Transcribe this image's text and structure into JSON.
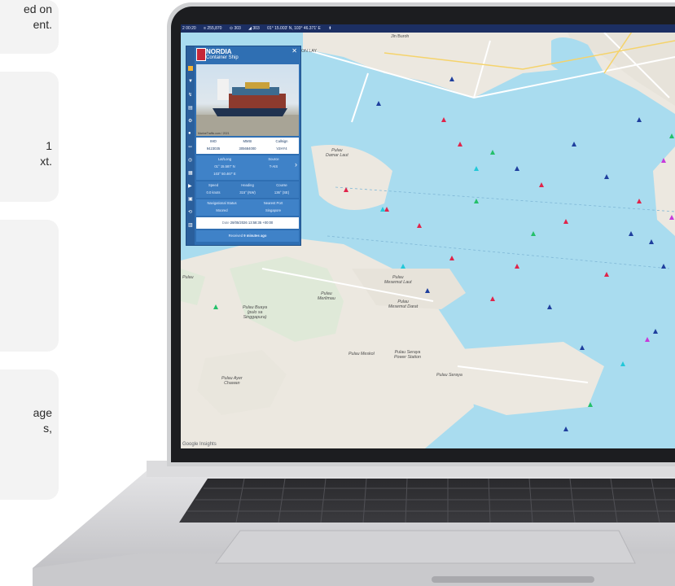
{
  "cards": [
    {
      "lines": [
        "ed on",
        "ent."
      ]
    },
    {
      "lines": [
        "1",
        "xt."
      ]
    },
    {
      "lines": []
    },
    {
      "lines": [
        "age",
        "s,"
      ]
    }
  ],
  "statusbar": {
    "items": [
      "2 00:20",
      "≡ 255,870",
      "⊙ 303",
      "◢ 303",
      "01° 15.003' N, 103° 46.371' E",
      "⬆"
    ]
  },
  "vessel": {
    "name": "NORDIA",
    "type": "Container Ship",
    "photo_caption": "MarineTraffic.com / 2021",
    "imo_label": "IMO",
    "imo": "9423035",
    "mmsi_label": "MMSI",
    "mmsi": "305684000",
    "callsign_label": "Callsign",
    "callsign": "V2HY4",
    "latlong_label": "Lat/Long",
    "lat": "01° 15.587' N",
    "long": "103° 50.467' E",
    "source_label": "Source",
    "source": "T-AIS",
    "speed_label": "Speed",
    "speed": "0.0 knots",
    "heading_label": "Heading",
    "heading": "315° (NW)",
    "course_label": "Course",
    "course": "136° (SE)",
    "navstatus_label": "Navigational Status",
    "navstatus": "Moored",
    "port_label": "Nearest Port",
    "port": "Singapore",
    "date_label": "Date",
    "date": "28/05/2026 13:58:35 +00:00",
    "received_label": "Received",
    "received": "9 minutes ago"
  },
  "map": {
    "labels": {
      "pulau_damar_laut": "Pulau\nDamar Laut",
      "pulau_merlimau": "Pulau\nMerlimau",
      "pulau_buaya": "Pulau Buaya\n(pulo sa\nSinggapura)",
      "pulau_mesemut_laut": "Pulau\nMesemut Laut",
      "pulau_mesemut_darat": "Pulau\nMesemut Darat",
      "pulau_meskol": "Pulau Meskol",
      "pulau_seraya_power": "Pulau Seraya\nPower Station",
      "pulau_seraya": "Pulau Seraya",
      "pulau_ayer_chawan": "Pulau Ayer\nChawan",
      "pulau_left": "Pulau",
      "jurong_island": "ON LAY",
      "jln_buroh": "Jln Buroh"
    },
    "attribution": "Google  Insights"
  }
}
